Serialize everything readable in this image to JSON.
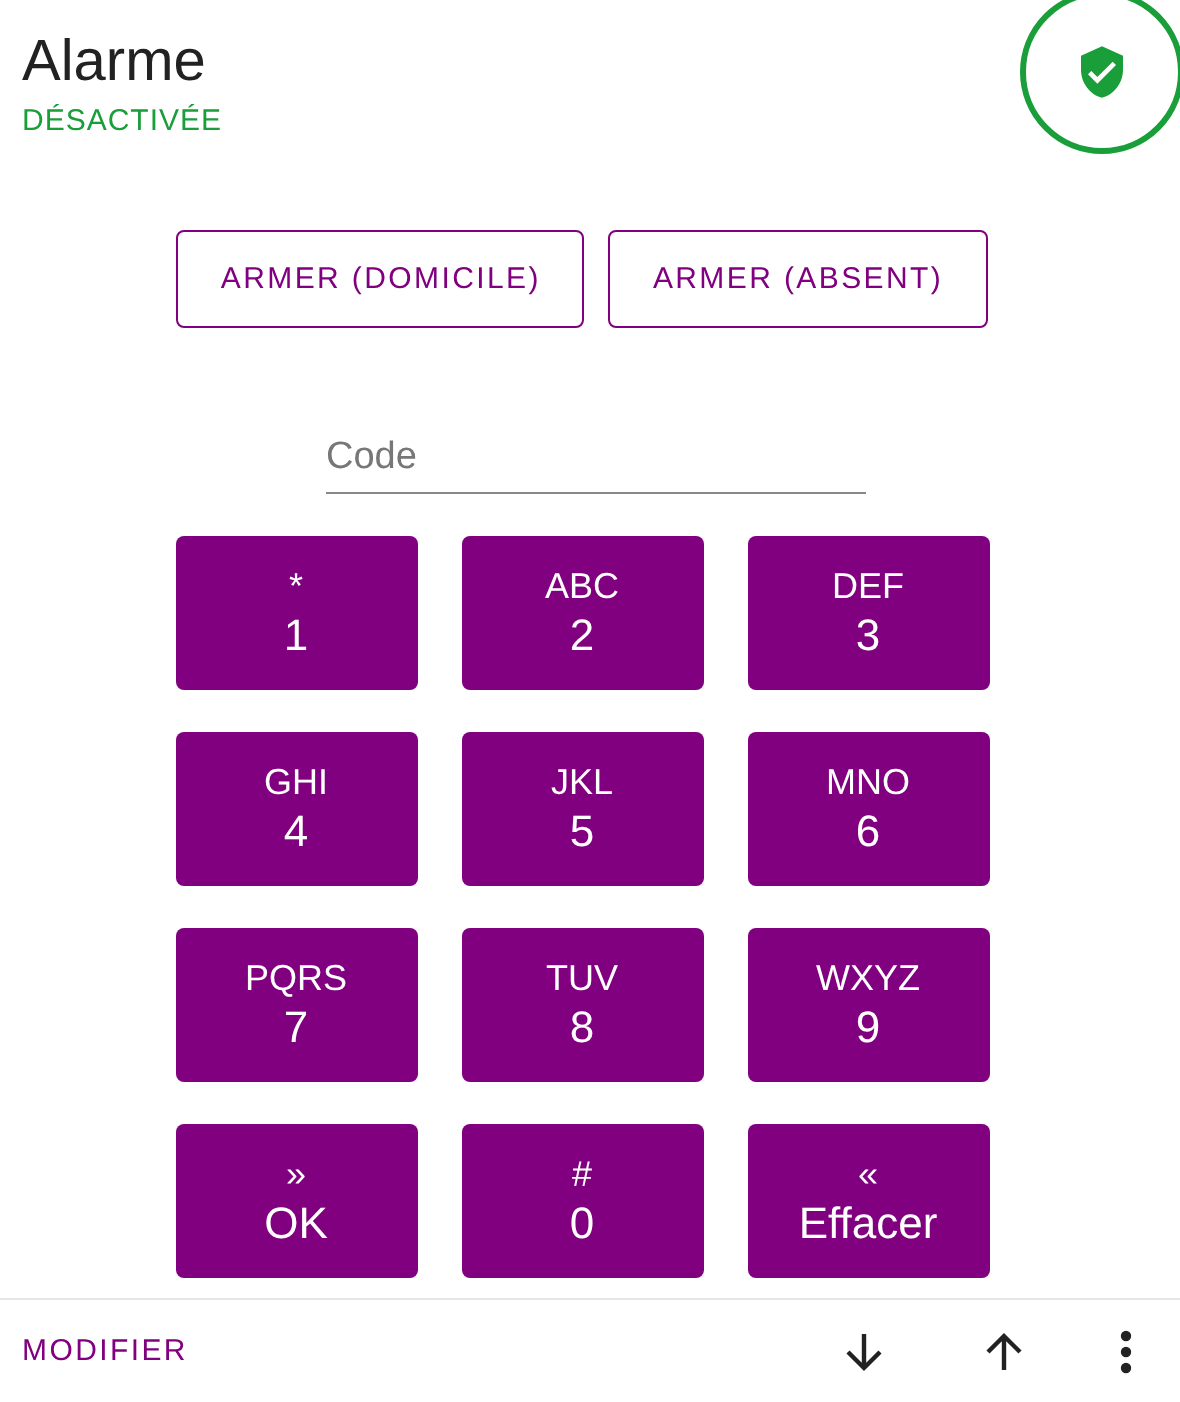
{
  "header": {
    "title": "Alarme",
    "status": "DÉSACTIVÉE"
  },
  "arm_buttons": [
    "ARMER (DOMICILE)",
    "ARMER (ABSENT)"
  ],
  "code_field": {
    "placeholder": "Code"
  },
  "keypad": [
    {
      "letters": "*",
      "digit": "1"
    },
    {
      "letters": "ABC",
      "digit": "2"
    },
    {
      "letters": "DEF",
      "digit": "3"
    },
    {
      "letters": "GHI",
      "digit": "4"
    },
    {
      "letters": "JKL",
      "digit": "5"
    },
    {
      "letters": "MNO",
      "digit": "6"
    },
    {
      "letters": "PQRS",
      "digit": "7"
    },
    {
      "letters": "TUV",
      "digit": "8"
    },
    {
      "letters": "WXYZ",
      "digit": "9"
    },
    {
      "letters": "»",
      "digit": "OK"
    },
    {
      "letters": "#",
      "digit": "0"
    },
    {
      "letters": "«",
      "digit": "Effacer"
    }
  ],
  "footer": {
    "action": "MODIFIER"
  }
}
